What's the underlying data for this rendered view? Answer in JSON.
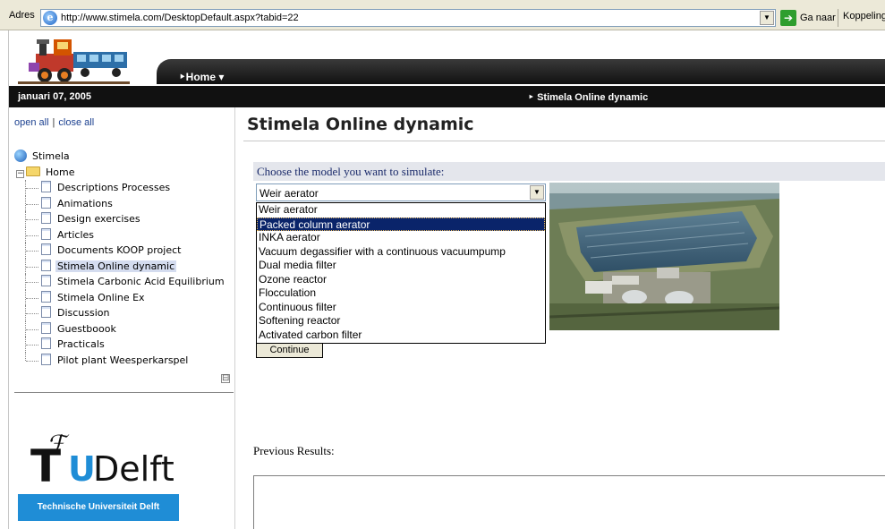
{
  "browser": {
    "address_label": "Adres",
    "url": "http://www.stimela.com/DesktopDefault.aspx?tabid=22",
    "go_label": "Ga naar",
    "links_label": "Koppelingen"
  },
  "header": {
    "home_menu": "‣Home ▾",
    "date": "januari 07, 2005",
    "breadcrumb": "‣ Stimela Online dynamic"
  },
  "sidebar": {
    "open_all": "open all",
    "close_all": "close all",
    "root": "Stimela",
    "home": "Home",
    "items": [
      {
        "label": "Descriptions Processes"
      },
      {
        "label": "Animations"
      },
      {
        "label": "Design exercises"
      },
      {
        "label": "Articles"
      },
      {
        "label": "Documents KOOP project"
      },
      {
        "label": "Stimela Online dynamic",
        "selected": true
      },
      {
        "label": "Stimela Carbonic Acid Equilibrium"
      },
      {
        "label": "Stimela Online Ex"
      },
      {
        "label": "Discussion"
      },
      {
        "label": "Guestboook"
      },
      {
        "label": "Practicals"
      },
      {
        "label": "Pilot plant Weesperkarspel"
      }
    ],
    "collapse_symbol": "⊟"
  },
  "logo": {
    "wordmark_u": "U",
    "wordmark_delft": "Delft",
    "banner": "Technische Universiteit Delft"
  },
  "main": {
    "title": "Stimela Online dynamic",
    "choose_label": "Choose the model you want to simulate:",
    "selected_model": "Weir aerator",
    "options": [
      "Weir aerator",
      "Packed column aerator",
      "INKA aerator",
      "Vacuum degassifier with a continuous vacuumpump",
      "Dual media filter",
      "Ozone reactor",
      "Flocculation",
      "Continuous filter",
      "Softening reactor",
      "Activated carbon filter"
    ],
    "highlighted_option_index": 1,
    "continue_label": "Continue",
    "previous_results_label": "Previous Results:"
  },
  "colors": {
    "dark_bar": "#111111",
    "selection": "#0a246a",
    "tud_blue": "#1f8dd6"
  }
}
